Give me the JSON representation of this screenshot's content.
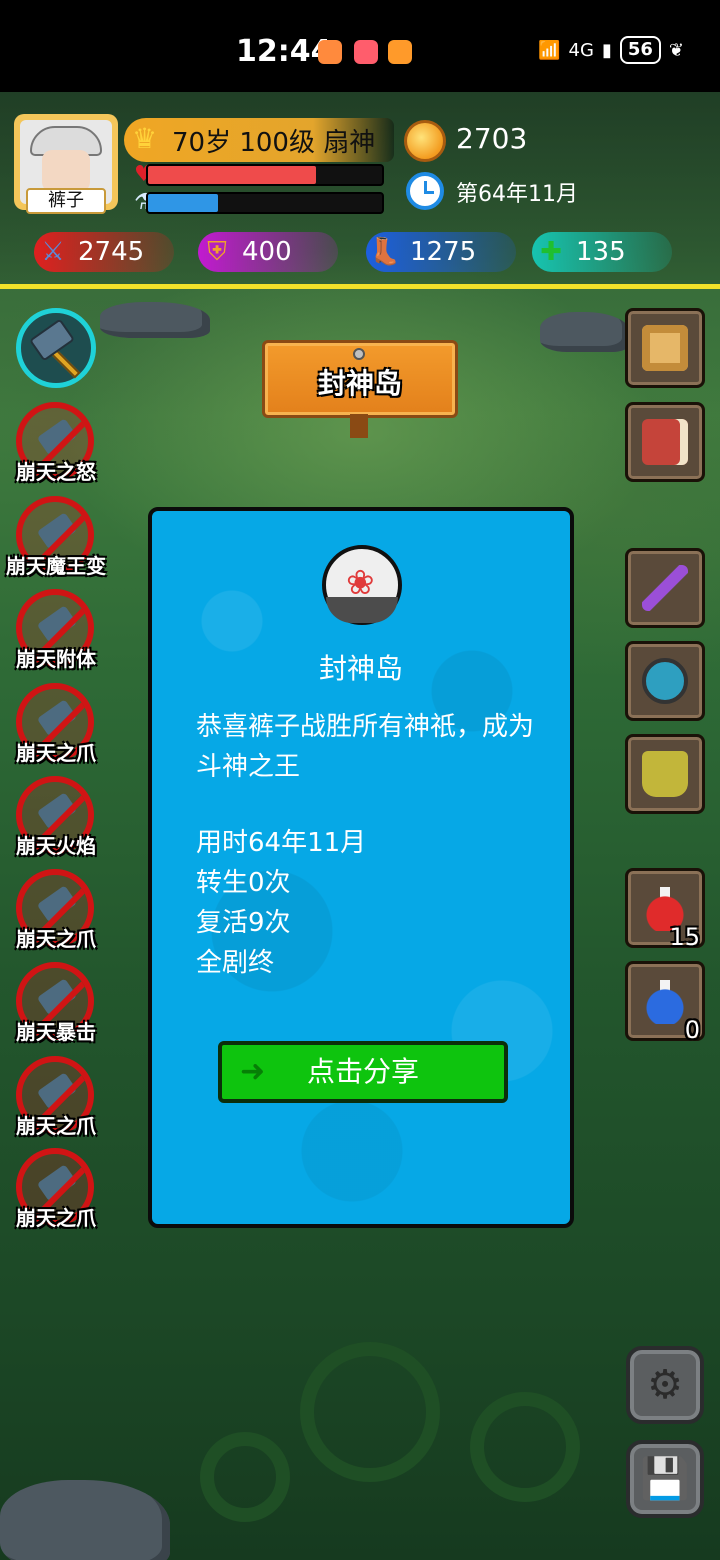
{
  "status_bar": {
    "time": "12:44",
    "network": "4G",
    "battery": "56"
  },
  "player": {
    "avatar_name": "裤子",
    "title": "70岁 100级 扇神",
    "gold": "2703",
    "date": "第64年11月",
    "hp_fraction": 0.72,
    "mp_fraction": 0.3
  },
  "stats": {
    "attack": "2745",
    "defense": "400",
    "speed": "1275",
    "health": "135"
  },
  "skills": [
    {
      "label": "崩天之怒"
    },
    {
      "label": "崩天魔王变"
    },
    {
      "label": "崩天附体"
    },
    {
      "label": "崩天之爪"
    },
    {
      "label": "崩天火焰"
    },
    {
      "label": "崩天之爪"
    },
    {
      "label": "崩天暴击"
    },
    {
      "label": "崩天之爪"
    },
    {
      "label": "崩天之爪"
    }
  ],
  "location_sign": "封神岛",
  "inventory": {
    "red_potion_count": "15",
    "blue_potion_count": "0"
  },
  "dialog": {
    "title": "封神岛",
    "message": "恭喜裤子战胜所有神祇，成为斗神之王",
    "time_used": "用时64年11月",
    "rebirths": "转生0次",
    "revives": "复活9次",
    "ending": "全剧终",
    "share_button": "点击分享"
  }
}
